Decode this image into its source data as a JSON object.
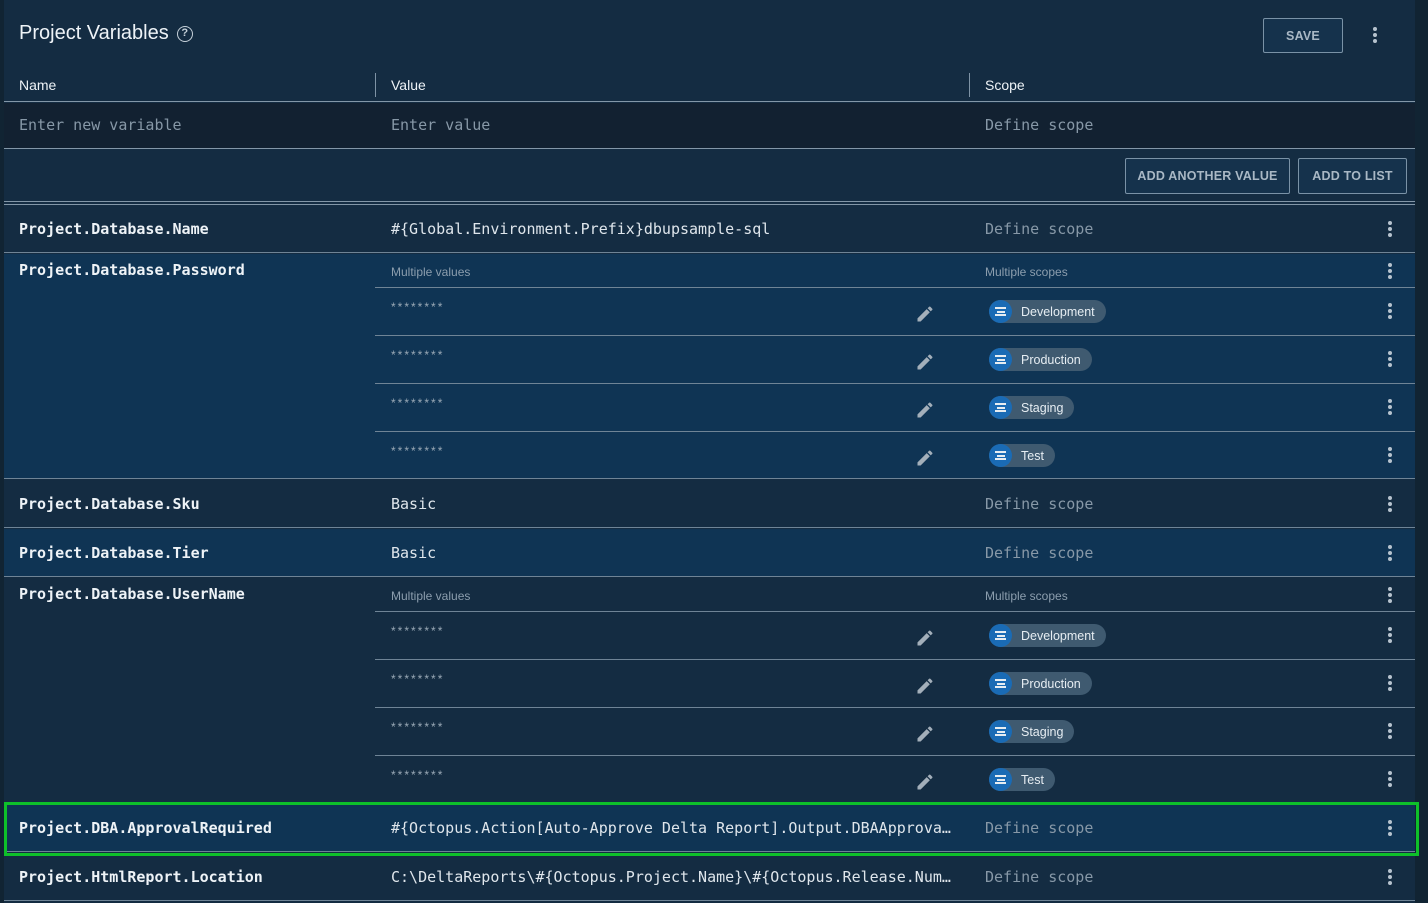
{
  "header": {
    "title": "Project Variables",
    "help_icon": "help-circle-icon",
    "save_label": "SAVE",
    "more_icon": "more-vertical-icon"
  },
  "columns": {
    "name": "Name",
    "value": "Value",
    "scope": "Scope"
  },
  "new_variable": {
    "name_placeholder": "Enter new variable",
    "value_placeholder": "Enter value",
    "scope_placeholder": "Define scope"
  },
  "actions": {
    "add_another_value": "ADD ANOTHER VALUE",
    "add_to_list": "ADD TO LIST"
  },
  "labels": {
    "multiple_values": "Multiple values",
    "multiple_scopes": "Multiple scopes",
    "define_scope": "Define scope"
  },
  "colors": {
    "accent_highlight": "#0ec02a",
    "chip_icon": "#1a6bb5",
    "row_blue": "#0f3454",
    "row_dark": "#142c42"
  },
  "variables": [
    {
      "name": "Project.Database.Name",
      "value": "#{Global.Environment.Prefix}dbupsample-sql",
      "scope": "Define scope"
    },
    {
      "name": "Project.Database.Password",
      "multi": true,
      "values": [
        {
          "value": "********",
          "scope": "Development"
        },
        {
          "value": "********",
          "scope": "Production"
        },
        {
          "value": "********",
          "scope": "Staging"
        },
        {
          "value": "********",
          "scope": "Test"
        }
      ]
    },
    {
      "name": "Project.Database.Sku",
      "value": "Basic",
      "scope": "Define scope"
    },
    {
      "name": "Project.Database.Tier",
      "value": "Basic",
      "scope": "Define scope"
    },
    {
      "name": "Project.Database.UserName",
      "multi": true,
      "values": [
        {
          "value": "********",
          "scope": "Development"
        },
        {
          "value": "********",
          "scope": "Production"
        },
        {
          "value": "********",
          "scope": "Staging"
        },
        {
          "value": "********",
          "scope": "Test"
        }
      ]
    },
    {
      "name": "Project.DBA.ApprovalRequired",
      "value": "#{Octopus.Action[Auto-Approve Delta Report].Output.DBAApprovalRequired}",
      "scope": "Define scope",
      "highlighted": true
    },
    {
      "name": "Project.HtmlReport.Location",
      "value": "C:\\DeltaReports\\#{Octopus.Project.Name}\\#{Octopus.Release.Number}",
      "scope": "Define scope"
    }
  ]
}
